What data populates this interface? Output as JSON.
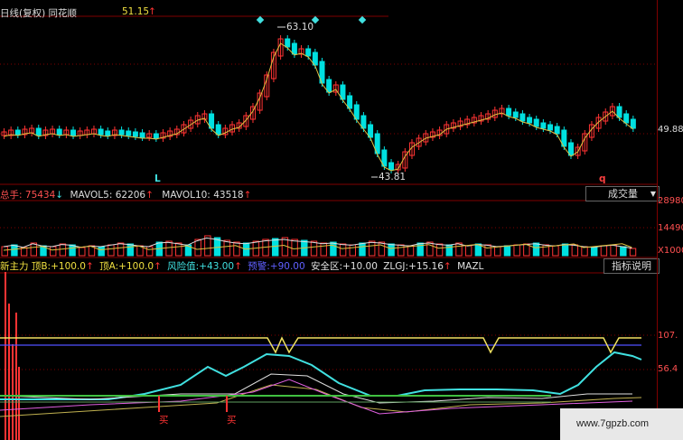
{
  "header": {
    "title": "日线(复权) 同花顺",
    "price": "51.15",
    "arrow": "↑"
  },
  "price_panel": {
    "high_label": "63.10",
    "low_label": "43.81",
    "axis_label": "49.88",
    "marker_left": "L",
    "marker_right": "q",
    "high_value": 63.1,
    "low_value": 43.81
  },
  "volume_panel": {
    "label_total": "总手:",
    "total": "75434",
    "total_arrow": "↓",
    "label_ma5": "MAVOL5:",
    "ma5": "62206",
    "ma5_arrow": "↑",
    "label_ma10": "MAVOL10:",
    "ma10": "43518",
    "ma10_arrow": "↑",
    "dropdown": "成交量",
    "axis": [
      "28980",
      "14490",
      "X1000"
    ]
  },
  "indicator_panel": {
    "items": [
      {
        "label": "新主力 顶B:",
        "value": "+100.0",
        "arrow": "↑",
        "color": "#f0e040"
      },
      {
        "label": "顶A:",
        "value": "+100.0",
        "arrow": "↑",
        "color": "#f0e040"
      },
      {
        "label": "风险值:",
        "value": "+43.00",
        "arrow": "↑",
        "color": "#40e0e0"
      },
      {
        "label": "预警:",
        "value": "+90.00",
        "arrow": "",
        "color": "#6060ff"
      },
      {
        "label": "安全区:",
        "value": "+10.00",
        "arrow": "",
        "color": "#e0e0e0"
      },
      {
        "label": "ZLGJ:",
        "value": "+15.16",
        "arrow": "↑",
        "color": "#e0e0e0"
      },
      {
        "label": "MAZL",
        "value": "",
        "arrow": "",
        "color": "#e0e0e0"
      }
    ],
    "help_button": "指标说明",
    "axis": [
      "107.",
      "56.4"
    ],
    "buy_label": "买"
  },
  "watermark": "www.7gpzb.com",
  "colors": {
    "up": "#ff3333",
    "down": "#00e0e0",
    "ma": "#e0c040",
    "grid": "#800000"
  }
}
